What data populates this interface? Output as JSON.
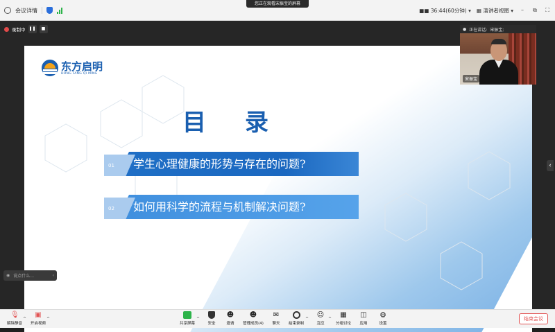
{
  "topbar": {
    "meeting_details": "会议详情",
    "toast": "您正在观看宋振宝的屏幕",
    "timer": "36:44(60分钟)",
    "view_mode": "演讲者视图"
  },
  "recording": {
    "label": "录制中"
  },
  "slide": {
    "logo_cn": "东方启明",
    "logo_en": "DONG FANG QI MING",
    "title": "目录",
    "items": [
      {
        "num": "01",
        "text": "学生心理健康的形势与存在的问题?"
      },
      {
        "num": "02",
        "text": "如何用科学的流程与机制解决问题?"
      }
    ]
  },
  "presenter": {
    "speaking_label": "正在讲话:",
    "speaking_name": "宋振宝;",
    "name_tag": "宋振宝"
  },
  "chat": {
    "placeholder": "说点什么..."
  },
  "toolbar": {
    "unmute": "解除静音",
    "start_video": "开启视频",
    "share_screen": "共享屏幕",
    "security": "安全",
    "invite": "邀请",
    "participants": "管理成员(4)",
    "chat": "聊天",
    "stop_recording": "结束录制",
    "reactions": "互应",
    "breakout": "分组讨论",
    "apps": "应用",
    "settings": "设置",
    "end_meeting": "结束会议"
  },
  "colors": {
    "brand_blue": "#1a5fb0",
    "end_red": "#e25555",
    "signal_green": "#2db34a"
  }
}
